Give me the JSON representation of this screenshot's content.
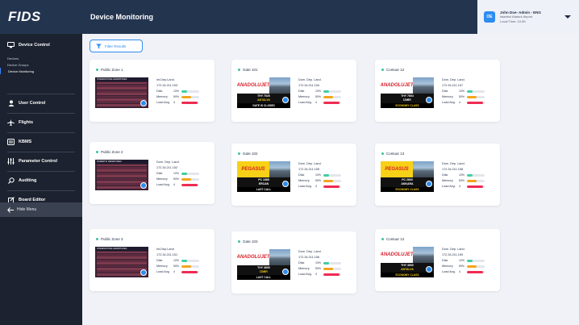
{
  "app": {
    "logo": "FIDS",
    "page_title": "Device Monitoring"
  },
  "user": {
    "initials": "OE",
    "name": "John Doe- Admin - ENG",
    "location": "Istanbul Ataturk Airport",
    "time": "Local Time: 10:55"
  },
  "sidebar": {
    "device_control": "Device Control",
    "sub_items": [
      "Devices",
      "Device Groups",
      "Device Monitoring"
    ],
    "items": [
      "User Control",
      "Flights",
      "KBMS",
      "Parameter Control",
      "Auditing",
      "Board Editor"
    ],
    "hide_menu": "Hide Menu"
  },
  "filter_label": "Filter Results",
  "metric_labels": {
    "disk": "Disk",
    "memory": "Memory",
    "load": "Load Avg."
  },
  "colors": {
    "disk": "#3fcf9f",
    "memory": "#f4a51c",
    "load": "#ee2b52",
    "active": "#3fbfa0",
    "accent": "#2d8cf0"
  },
  "cards": [
    {
      "title": "Public Zone 1",
      "type": "Int.Dep.Land.",
      "ip": "172.34.211.153",
      "disk": "10%",
      "memory": "50%",
      "load": "4",
      "disk_v": 0.3,
      "mem_v": 0.55,
      "load_v": 0.9,
      "thumb": "fids",
      "board_title": "INTERNATIONAL DEPARTURES"
    },
    {
      "title": "Gate 101",
      "type": "Dom. Dep. Land.",
      "ip": "172.34.211.154",
      "disk": "10%",
      "memory": "50%",
      "load": "4",
      "disk_v": 0.3,
      "mem_v": 0.55,
      "load_v": 0.9,
      "thumb": "air",
      "brand": "ANADOLUJET",
      "brand_color": "#ffffff",
      "brand_text": "#d8202a",
      "flight": "THY 7020",
      "city": "ANTALYA",
      "gate_time": "13:30",
      "status": "GATE IS CLOSED",
      "status_bg": "#000000",
      "status_color": "#ffffff",
      "city_color": "#f7d117"
    },
    {
      "title": "Contuar 12",
      "type": "Dom. Dep. Land.",
      "ip": "172.34.211.157",
      "disk": "10%",
      "memory": "50%",
      "load": "4",
      "disk_v": 0.3,
      "mem_v": 0.55,
      "load_v": 0.9,
      "thumb": "air",
      "brand": "ANADOLUJET",
      "brand_color": "#ffffff",
      "brand_text": "#d8202a",
      "flight": "THY 7604",
      "city": "İZMİR",
      "gate_time": "14:00",
      "status": "ECONOMY CLASS",
      "status_bg": "#000000",
      "status_color": "#f7d117",
      "city_color": "#ffffff"
    },
    {
      "title": "Public Zone 2",
      "type": "Dom. Dep. Land.",
      "ip": "172.34.211.152",
      "disk": "10%",
      "memory": "50%",
      "load": "4",
      "disk_v": 0.3,
      "mem_v": 0.55,
      "load_v": 0.9,
      "thumb": "fids",
      "board_title": "DOMESTIC DEPARTURES"
    },
    {
      "title": "Gate 102",
      "type": "Dom. Dep. Land.",
      "ip": "172.34.211.155",
      "disk": "10%",
      "memory": "50%",
      "load": "4",
      "disk_v": 0.3,
      "mem_v": 0.55,
      "load_v": 0.9,
      "thumb": "air",
      "brand": "PEGASUS",
      "brand_color": "#f7d117",
      "brand_text": "#d8202a",
      "flight": "PC 1985",
      "city": "ERCAN",
      "gate_time": "13:55",
      "status": "LAST CALL",
      "status_bg": "#000000",
      "status_color": "#ffffff",
      "city_color": "#ffffff"
    },
    {
      "title": "Contuar 13",
      "type": "Dom. Dep. Land.",
      "ip": "172.34.211.158",
      "disk": "10%",
      "memory": "50%",
      "load": "4",
      "disk_v": 0.3,
      "mem_v": 0.55,
      "load_v": 0.9,
      "thumb": "air",
      "brand": "PEGASUS",
      "brand_color": "#f7d117",
      "brand_text": "#d8202a",
      "flight": "PC 2600",
      "city": "ANKARA",
      "gate_time": "13:55",
      "status": "ECONOMY CLASS",
      "status_bg": "#000000",
      "status_color": "#f7d117",
      "city_color": "#ffffff"
    },
    {
      "title": "Public Zone 3",
      "type": "Int.Dep.Land",
      "ip": "172.34.211.151",
      "disk": "10%",
      "memory": "50%",
      "load": "4",
      "disk_v": 0.3,
      "mem_v": 0.55,
      "load_v": 0.9,
      "thumb": "fids",
      "board_title": "INTERNATIONAL DEPARTURES"
    },
    {
      "title": "Gate 103",
      "type": "Dom. Dep. Land.",
      "ip": "172.34.211.156",
      "disk": "10%",
      "memory": "50%",
      "load": "4",
      "disk_v": 0.3,
      "mem_v": 0.55,
      "load_v": 0.9,
      "thumb": "air",
      "brand": "ANADOLUJET",
      "brand_color": "#ffffff",
      "brand_text": "#d8202a",
      "flight": "THY 3600",
      "city": "İZMİR",
      "gate_time": "13:30",
      "status": "LAST CALL",
      "status_bg": "#000000",
      "status_color": "#ffffff",
      "city_color": "#f7d117"
    },
    {
      "title": "Contuar 12",
      "type": "Dom. Dep. Land.",
      "ip": "172.34.211.159",
      "disk": "10%",
      "memory": "50%",
      "load": "4",
      "disk_v": 0.3,
      "mem_v": 0.55,
      "load_v": 0.9,
      "thumb": "air",
      "brand": "ANADOLUJET",
      "brand_color": "#ffffff",
      "brand_text": "#d8202a",
      "flight": "THY 3600",
      "city": "ANTALYA",
      "gate_time": "13:30",
      "status": "ECONOMY CLASS",
      "status_bg": "#000000",
      "status_color": "#f7d117",
      "city_color": "#f7d117"
    }
  ]
}
